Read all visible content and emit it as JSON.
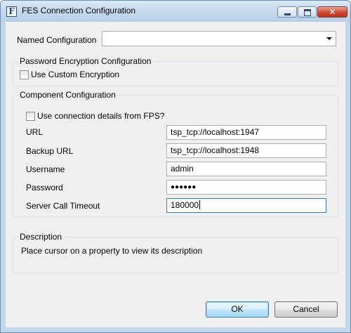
{
  "window": {
    "title": "FES Connection Configuration",
    "icon": "F",
    "close_glyph": "✕"
  },
  "named_configuration": {
    "label": "Named Configuration",
    "value": ""
  },
  "password_group": {
    "title": "Password Encryption Configuration",
    "use_custom_encryption": {
      "label": "Use Custom Encryption",
      "checked": false
    }
  },
  "component_group": {
    "title": "Component Configuration",
    "use_fps": {
      "label": "Use connection details from FPS?",
      "checked": false
    },
    "url": {
      "label": "URL",
      "value": "tsp_tcp://localhost:1947"
    },
    "backup_url": {
      "label": "Backup URL",
      "value": "tsp_tcp://localhost:1948"
    },
    "username": {
      "label": "Username",
      "value": "admin"
    },
    "password": {
      "label": "Password",
      "value": "●●●●●●"
    },
    "timeout": {
      "label": "Server Call Timeout",
      "value": "180000"
    }
  },
  "description": {
    "title": "Description",
    "text": "Place cursor on a property to view its description"
  },
  "buttons": {
    "ok": "OK",
    "cancel": "Cancel"
  }
}
